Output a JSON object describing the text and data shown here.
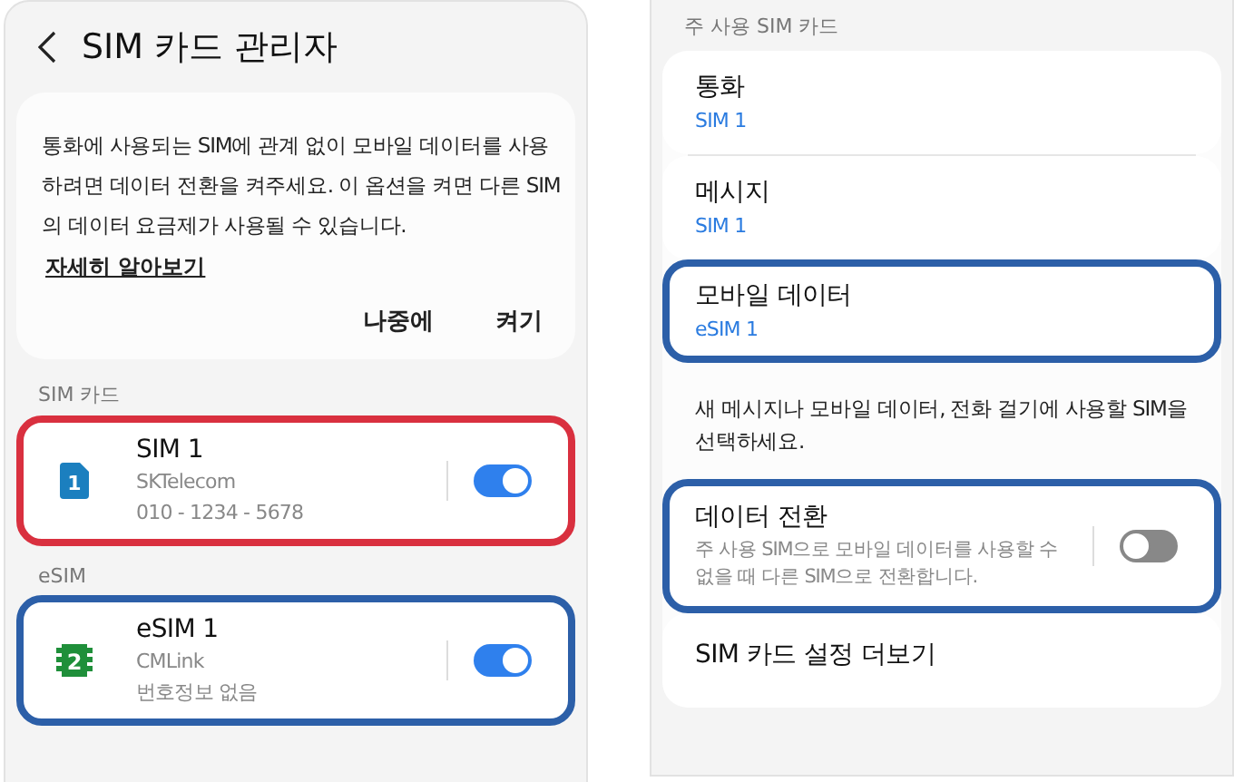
{
  "left": {
    "title": "SIM 카드 관리자",
    "notice": {
      "text": "통화에 사용되는 SIM에 관계 없이 모바일 데이터를 사용하려면 데이터 전환을 켜주세요. 이 옵션을 켜면 다른 SIM의 데이터 요금제가 사용될 수 있습니다.",
      "link": "자세히 알아보기",
      "buttons": [
        "나중에",
        "켜기"
      ]
    },
    "sections": [
      {
        "label": "SIM 카드",
        "items": [
          {
            "kind": "physical",
            "badge": "1",
            "name": "SIM 1",
            "carrier": "SKTelecom",
            "number": "010 - 1234 - 5678",
            "on": true,
            "color": "#d9303f"
          }
        ]
      },
      {
        "label": "eSIM",
        "items": [
          {
            "kind": "esim",
            "badge": "2",
            "name": "eSIM 1",
            "carrier": "CMLink",
            "number": "번호정보 없음",
            "on": true,
            "color": "#2c5fa8"
          }
        ]
      }
    ]
  },
  "right": {
    "section_label": "주 사용 SIM 카드",
    "items": [
      {
        "kind": "choice",
        "title": "통화",
        "value": "SIM 1"
      },
      {
        "kind": "choice",
        "title": "메시지",
        "value": "SIM 1"
      },
      {
        "kind": "choice",
        "title": "모바일 데이터",
        "value": "eSIM 1",
        "color": "#2c5fa8"
      },
      {
        "kind": "note",
        "text": "새 메시지나 모바일 데이터, 전화 걸기에 사용할 SIM을 선택하세요."
      },
      {
        "kind": "toggle",
        "title": "데이터 전환",
        "text": "주 사용 SIM으로 모바일 데이터를 사용할 수 없을 때 다른 SIM으로 전환합니다.",
        "on": false,
        "color": "#2c5fa8"
      },
      {
        "kind": "link",
        "title": "SIM 카드 설정 더보기"
      }
    ]
  }
}
